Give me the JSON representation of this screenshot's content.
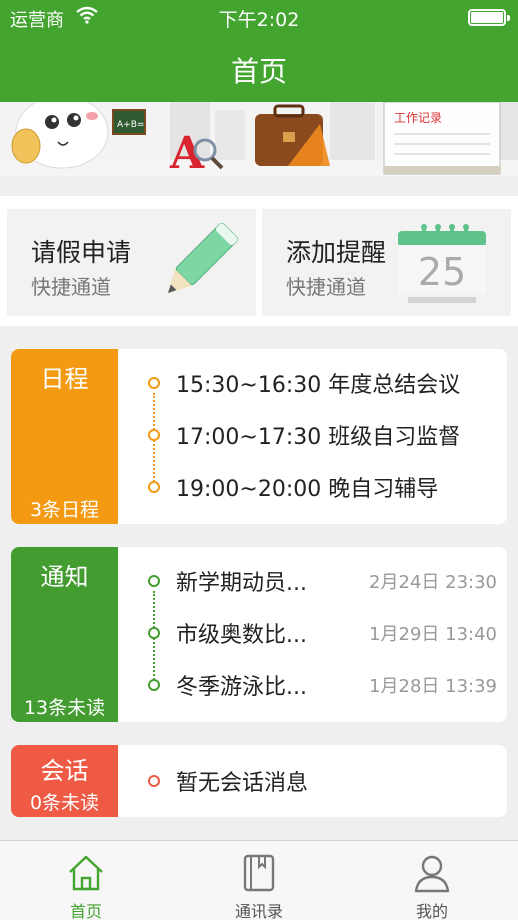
{
  "status_bar": {
    "carrier": "运营商",
    "time": "下午2:02"
  },
  "nav": {
    "title": "首页"
  },
  "banner": {
    "sign_text": "A+B=",
    "notebook_text": "工作记录"
  },
  "quick_actions": [
    {
      "title": "请假申请",
      "subtitle": "快捷通道",
      "icon": "pencil-icon"
    },
    {
      "title": "添加提醒",
      "subtitle": "快捷通道",
      "icon": "calendar-icon",
      "calendar_day": "25"
    }
  ],
  "schedule": {
    "label": "日程",
    "count": "3条日程",
    "color": "#f39a12",
    "items": [
      {
        "text": "15:30~16:30 年度总结会议"
      },
      {
        "text": "17:00~17:30 班级自习监督"
      },
      {
        "text": "19:00~20:00 晚自习辅导"
      }
    ]
  },
  "notices": {
    "label": "通知",
    "count": "13条未读",
    "color": "#439c30",
    "items": [
      {
        "text": "新学期动员...",
        "time": "2月24日 23:30"
      },
      {
        "text": "市级奥数比...",
        "time": "1月29日 13:40"
      },
      {
        "text": "冬季游泳比...",
        "time": "1月28日 13:39"
      }
    ]
  },
  "chats": {
    "label": "会话",
    "count": "0条未读",
    "color": "#ef5a45",
    "items": [
      {
        "text": "暂无会话消息"
      }
    ]
  },
  "tabbar": [
    {
      "label": "首页",
      "icon": "home-icon",
      "active": true
    },
    {
      "label": "通讯录",
      "icon": "contacts-book-icon",
      "active": false
    },
    {
      "label": "我的",
      "icon": "profile-icon",
      "active": false
    }
  ]
}
